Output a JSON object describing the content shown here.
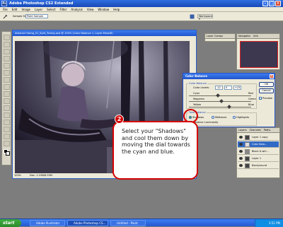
{
  "app_title": "Adobe Photoshop CS2 Extended",
  "menu": [
    "File",
    "Edit",
    "Image",
    "Layer",
    "Select",
    "Filter",
    "Analysis",
    "View",
    "Window",
    "Help"
  ],
  "options": {
    "sample_size_label": "Sample Size:",
    "sample_size_value": "Point Sample",
    "workspace_label": "Workspace ▾"
  },
  "document": {
    "title": "Abstract Swing_01_Split_Toning.psd @ 100% (Color Balance 1, Layer Mask/8)",
    "zoom": "100%",
    "doc_size": "Doc: 1.10M/6.55M"
  },
  "dialog": {
    "title": "Color Balance",
    "section_color_balance": "Color Balance",
    "color_levels_label": "Color Levels:",
    "levels": [
      "-12",
      "0",
      "+23"
    ],
    "sliders": [
      {
        "left": "Cyan",
        "right": "Red",
        "position": 0.44
      },
      {
        "left": "Magenta",
        "right": "Green",
        "position": 0.5
      },
      {
        "left": "Yellow",
        "right": "Blue",
        "position": 0.62
      }
    ],
    "section_tone_balance": "Tone Balance",
    "tones": [
      "Shadows",
      "Midtones",
      "Highlights"
    ],
    "selected_tone": "Shadows",
    "preserve_luminosity": "Preserve Luminosity",
    "buttons": {
      "ok": "OK",
      "cancel": "Cancel",
      "preview": "Preview"
    }
  },
  "callout": {
    "number": "2",
    "text": "Select your \"Shadows\" and cool them down by moving the dial towards the cyan and blue."
  },
  "panels": {
    "top_tabs": [
      "Navigator",
      "Info"
    ],
    "mid_tabs": [
      "Layer Comps"
    ],
    "layers_tabs": [
      "Layers",
      "Channels",
      "Paths"
    ],
    "layers": [
      "Layer 1 copy",
      "Color Bala...",
      "Black & whi...",
      "Layer 1",
      "Background"
    ]
  },
  "taskbar": {
    "start": "start",
    "tasks": [
      "Adobe Illustrator",
      "Adobe Photoshop CS...",
      "Untitled - Paint"
    ],
    "time": "3:51 PM"
  },
  "colors": {
    "callout_border": "#d40000",
    "xp_blue": "#2458d0"
  }
}
